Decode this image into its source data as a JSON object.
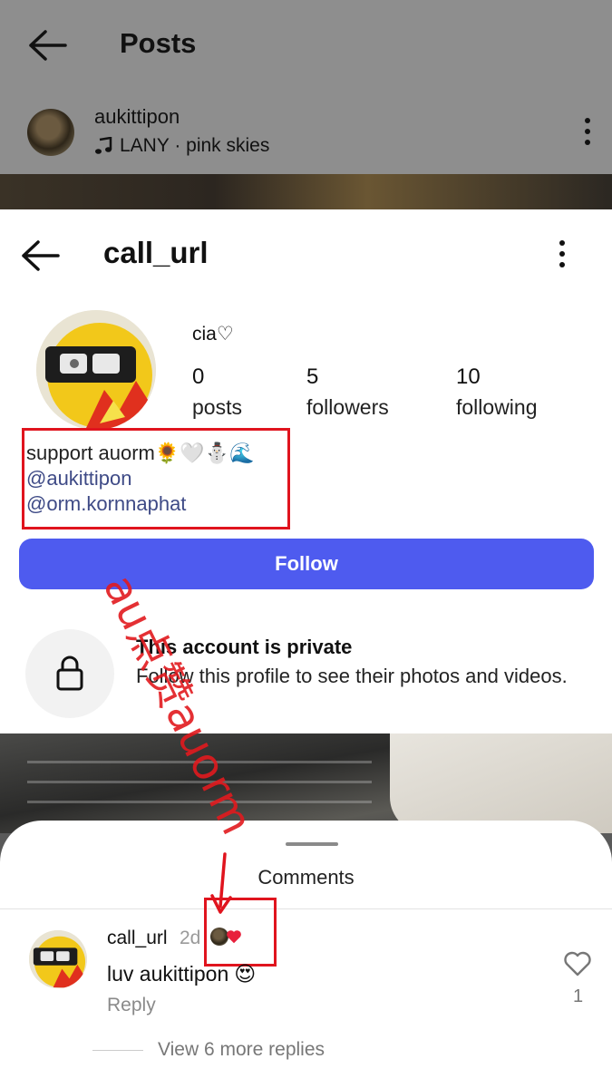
{
  "posts_header": {
    "title": "Posts",
    "author_username": "aukittipon",
    "music": "LANY · pink skies"
  },
  "profile": {
    "handle": "call_url",
    "display_name": "cia♡",
    "stats": [
      {
        "value": "0",
        "label": "posts"
      },
      {
        "value": "5",
        "label": "followers"
      },
      {
        "value": "10",
        "label": "following"
      }
    ],
    "bio": {
      "line1": "support auorm🌻🤍⛄🌊",
      "mentions": [
        "@aukittipon",
        "@orm.kornnaphat"
      ]
    },
    "follow_label": "Follow",
    "private_title": "This account is private",
    "private_desc": "Follow this profile to see their photos and videos."
  },
  "comments": {
    "title": "Comments",
    "items": [
      {
        "username": "call_url",
        "time": "2d",
        "text": "luv aukittipon",
        "emoji": "😍",
        "reply_label": "Reply",
        "like_count": "1"
      }
    ],
    "more_replies": "View 6 more replies"
  },
  "annotation": {
    "text": "au点赞auorm",
    "color": "#e0141e"
  },
  "colors": {
    "follow_button": "#4e5bef",
    "mention": "#3e4a86",
    "highlight": "#e0141e"
  },
  "icons": [
    "back-arrow-icon",
    "more-vertical-icon",
    "music-note-icon",
    "lock-icon",
    "heart-outline-icon",
    "heart-red-icon"
  ]
}
